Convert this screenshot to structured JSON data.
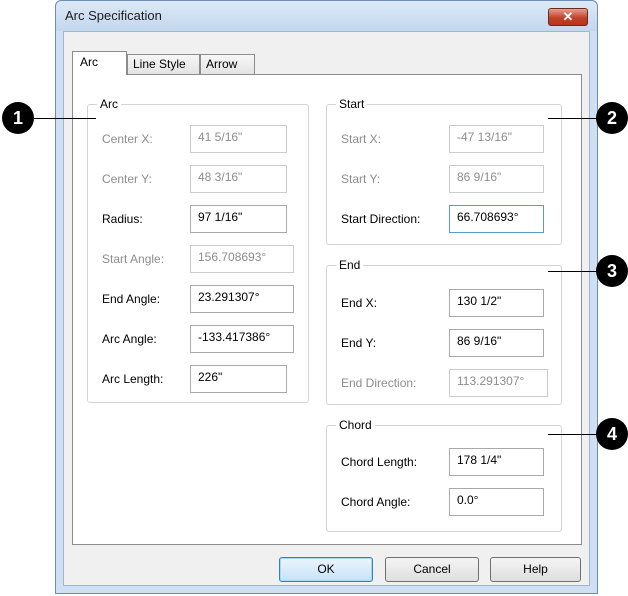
{
  "dialog": {
    "title": "Arc Specification",
    "close_glyph": "✕"
  },
  "tabs": [
    {
      "label": "Arc"
    },
    {
      "label": "Line Style"
    },
    {
      "label": "Arrow"
    }
  ],
  "arc_group": {
    "title": "Arc",
    "fields": [
      {
        "label": "Center X:",
        "value": "41 5/16\""
      },
      {
        "label": "Center Y:",
        "value": "48 3/16\""
      },
      {
        "label": "Radius:",
        "value": "97 1/16\""
      },
      {
        "label": "Start Angle:",
        "value": "156.708693°"
      },
      {
        "label": "End Angle:",
        "value": "23.291307°"
      },
      {
        "label": "Arc Angle:",
        "value": "-133.417386°"
      },
      {
        "label": "Arc Length:",
        "value": "226\""
      }
    ]
  },
  "start_group": {
    "title": "Start",
    "fields": [
      {
        "label": "Start X:",
        "value": "-47 13/16\""
      },
      {
        "label": "Start Y:",
        "value": "86 9/16\""
      },
      {
        "label": "Start Direction:",
        "value": "66.708693°"
      }
    ]
  },
  "end_group": {
    "title": "End",
    "fields": [
      {
        "label": "End X:",
        "value": "130 1/2\""
      },
      {
        "label": "End Y:",
        "value": "86 9/16\""
      },
      {
        "label": "End Direction:",
        "value": "113.291307°"
      }
    ]
  },
  "chord_group": {
    "title": "Chord",
    "fields": [
      {
        "label": "Chord Length:",
        "value": "178 1/4\""
      },
      {
        "label": "Chord Angle:",
        "value": "0.0°"
      }
    ]
  },
  "buttons": {
    "ok": "OK",
    "cancel": "Cancel",
    "help": "Help"
  },
  "callouts": [
    "1",
    "2",
    "3",
    "4"
  ],
  "colors": {
    "frame": "#cfe0f3",
    "close_button": "#c1422b",
    "callout": "#000000"
  }
}
